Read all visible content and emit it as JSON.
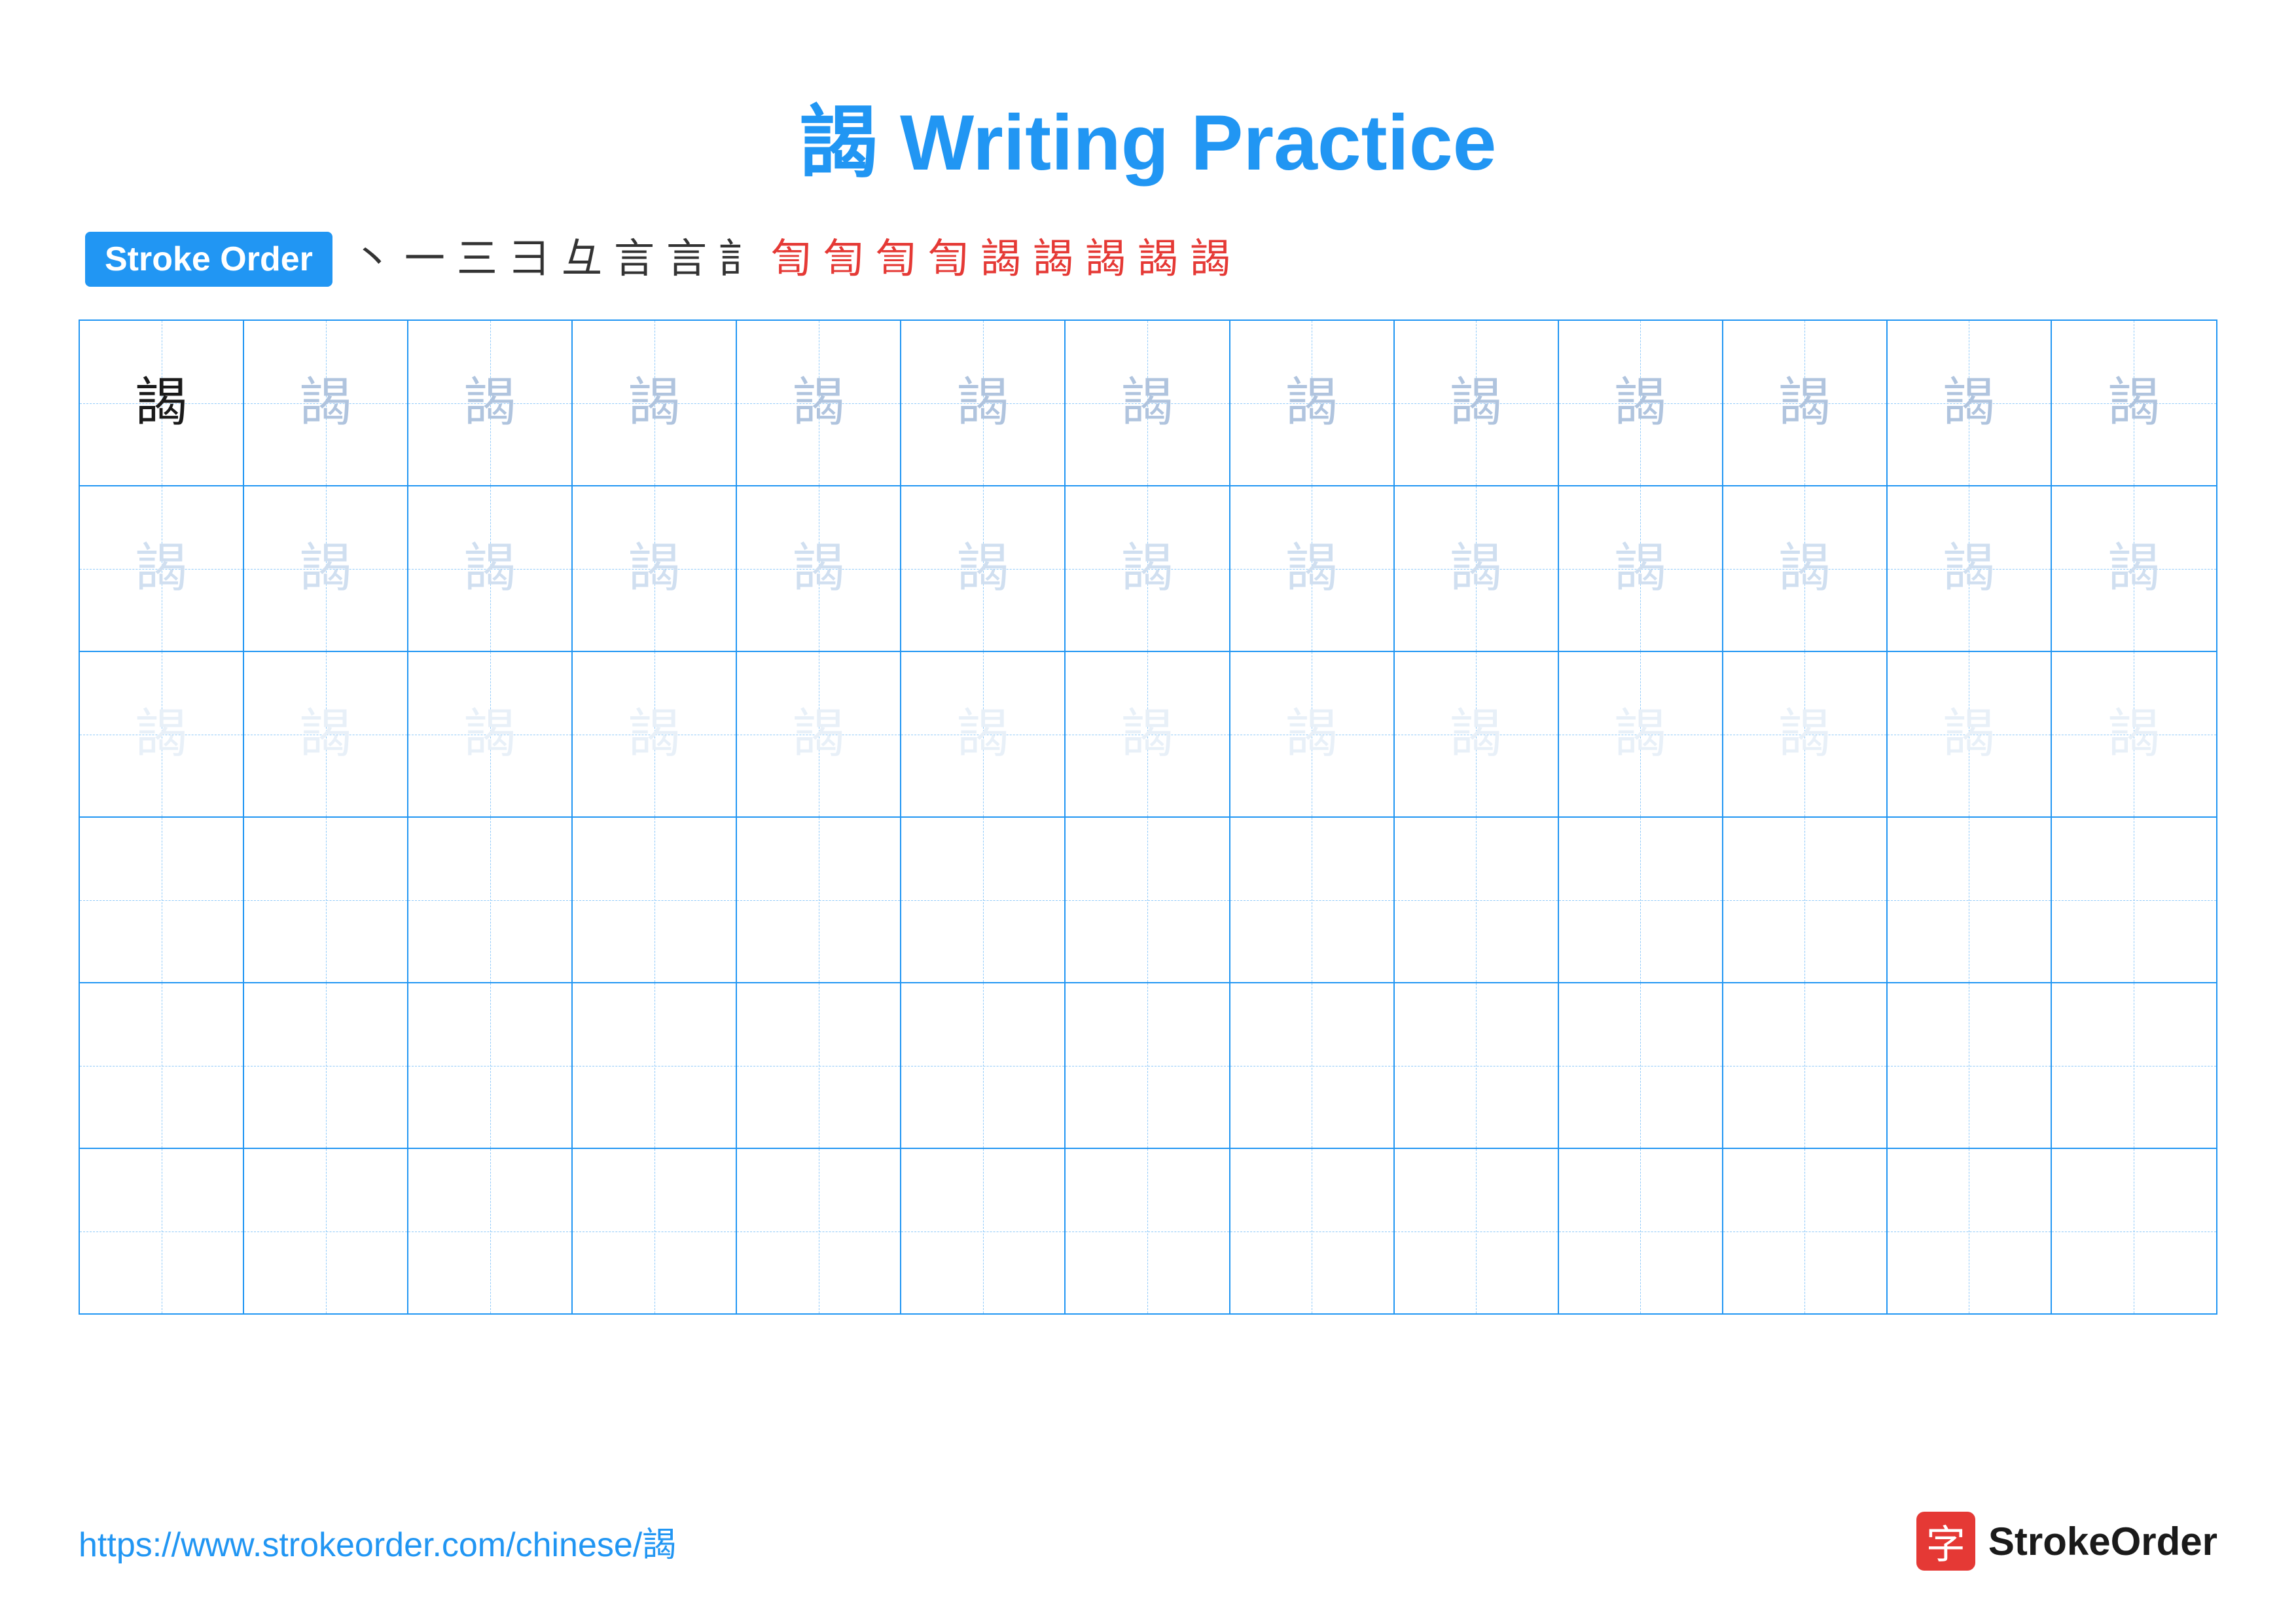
{
  "title": {
    "character": "謁",
    "label": "Writing Practice",
    "full": "謁 Writing Practice"
  },
  "stroke_order": {
    "badge_label": "Stroke Order",
    "steps": [
      "丶",
      "一",
      "三",
      "彐",
      "彑",
      "言",
      "言",
      "訁",
      "訇",
      "訇",
      "訇",
      "訇",
      "謁",
      "謁",
      "謁",
      "謁",
      "謁"
    ]
  },
  "grid": {
    "character": "謁",
    "rows": 6,
    "cols": 13
  },
  "footer": {
    "url": "https://www.strokeorder.com/chinese/謁",
    "logo_char": "字",
    "logo_name": "StrokeOrder"
  }
}
